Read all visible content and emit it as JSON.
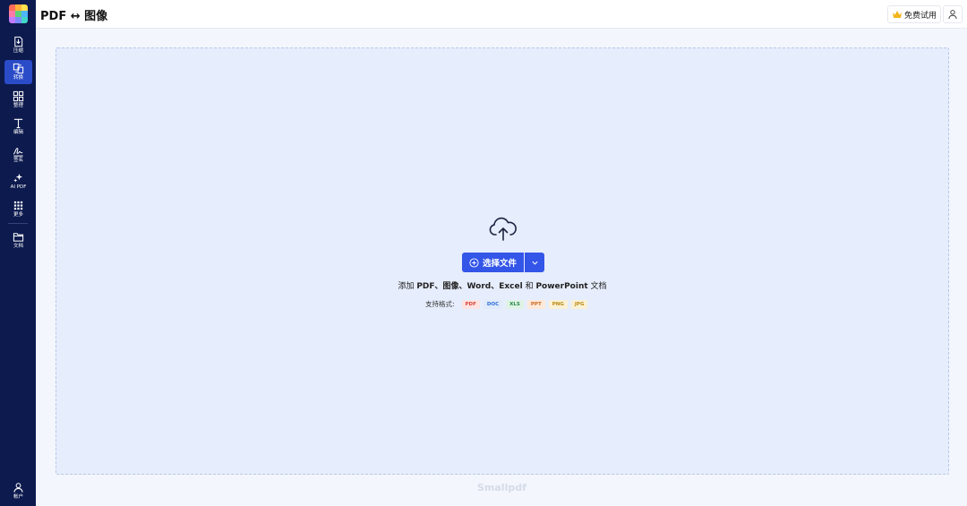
{
  "sidebar": {
    "items": [
      {
        "label": "压缩",
        "icon": "compress-icon"
      },
      {
        "label": "转换",
        "icon": "convert-icon"
      },
      {
        "label": "整理",
        "icon": "organize-icon"
      },
      {
        "label": "编辑",
        "icon": "text-edit-icon"
      },
      {
        "label": "签名",
        "icon": "signature-icon"
      },
      {
        "label": "AI PDF",
        "icon": "sparkle-icon"
      },
      {
        "label": "更多",
        "icon": "grid-dots-icon"
      },
      {
        "label": "文档",
        "icon": "folder-icon"
      }
    ],
    "account": {
      "label": "帐户",
      "icon": "user-icon"
    },
    "active_index": 1
  },
  "header": {
    "title": "PDF ↔ 图像",
    "trial_label": "免费试用",
    "trial_icon": "crown-icon",
    "user_icon": "user-icon"
  },
  "dropzone": {
    "upload_icon": "cloud-upload-icon",
    "select_label": "选择文件",
    "add_prefix": "添加 ",
    "add_bold_1": "PDF、图像、Word、Excel",
    "add_mid": " 和 ",
    "add_bold_2": "PowerPoint",
    "add_suffix": " 文档",
    "formats_label": "支持格式:",
    "formats": [
      {
        "label": "PDF",
        "color": "#d9443a",
        "bg": "#fde4e2"
      },
      {
        "label": "DOC",
        "color": "#2f6fd6",
        "bg": "#e0eafb"
      },
      {
        "label": "XLS",
        "color": "#238a46",
        "bg": "#dff3e5"
      },
      {
        "label": "PPT",
        "color": "#d06a21",
        "bg": "#fde9da"
      },
      {
        "label": "PNG",
        "color": "#b98a14",
        "bg": "#fbf1d4"
      },
      {
        "label": "JPG",
        "color": "#b98a14",
        "bg": "#fbf1d4"
      }
    ]
  },
  "watermark": "Smallpdf",
  "colors": {
    "sidebar_bg": "#0c1a4e",
    "active_nav": "#2b4cc8",
    "primary_button": "#3355e8",
    "dropzone_bg": "#e6edfc",
    "page_bg": "#f3f6fc"
  }
}
